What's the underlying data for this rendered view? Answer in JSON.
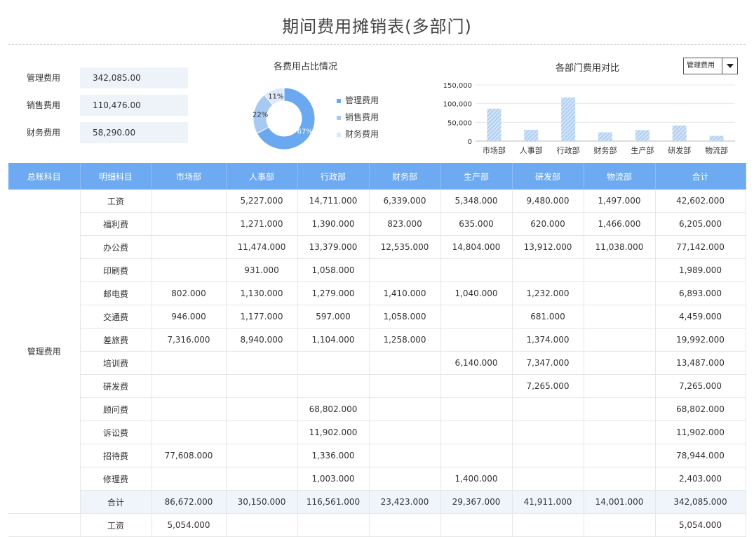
{
  "title": "期间费用摊销表(多部门)",
  "summary": [
    {
      "label": "管理费用",
      "value": "342,085.00"
    },
    {
      "label": "销售费用",
      "value": "110,476.00"
    },
    {
      "label": "财务费用",
      "value": "58,290.00"
    }
  ],
  "dropdown": {
    "selected": "管理费用"
  },
  "colors": {
    "header": "#6daaf1",
    "bar": "#a9cbee",
    "pie1": "#6aa8f0",
    "pie2": "#a7c9f2",
    "pie3": "#dde9f8"
  },
  "chart_data": [
    {
      "type": "pie",
      "title": "各费用占比情况",
      "categories": [
        "管理费用",
        "销售费用",
        "财务费用"
      ],
      "values": [
        67,
        22,
        11
      ],
      "labels": [
        "67%",
        "22%",
        "11%"
      ],
      "legend": "right"
    },
    {
      "type": "bar",
      "title": "各部门费用对比",
      "categories": [
        "市场部",
        "人事部",
        "行政部",
        "财务部",
        "生产部",
        "研发部",
        "物流部"
      ],
      "values": [
        86672,
        30150,
        116561,
        23423,
        29367,
        41911,
        14001
      ],
      "ylim": [
        0,
        150000
      ],
      "yticks": [
        0,
        50000,
        100000,
        150000
      ],
      "ytick_labels": [
        "0",
        "50,000",
        "100,000",
        "150,000"
      ],
      "grid": true
    }
  ],
  "table": {
    "headers": [
      "总账科目",
      "明细科目",
      "市场部",
      "人事部",
      "行政部",
      "财务部",
      "生产部",
      "研发部",
      "物流部",
      "合计"
    ],
    "group1": "管理费用",
    "rows": [
      [
        "工资",
        "",
        "5,227.000",
        "14,711.000",
        "6,339.000",
        "5,348.000",
        "9,480.000",
        "1,497.000",
        "42,602.000"
      ],
      [
        "福利费",
        "",
        "1,271.000",
        "1,390.000",
        "823.000",
        "635.000",
        "620.000",
        "1,466.000",
        "6,205.000"
      ],
      [
        "办公费",
        "",
        "11,474.000",
        "13,379.000",
        "12,535.000",
        "14,804.000",
        "13,912.000",
        "11,038.000",
        "77,142.000"
      ],
      [
        "印刷费",
        "",
        "931.000",
        "1,058.000",
        "",
        "",
        "",
        "",
        "1,989.000"
      ],
      [
        "邮电费",
        "802.000",
        "1,130.000",
        "1,279.000",
        "1,410.000",
        "1,040.000",
        "1,232.000",
        "",
        "6,893.000"
      ],
      [
        "交通费",
        "946.000",
        "1,177.000",
        "597.000",
        "1,058.000",
        "",
        "681.000",
        "",
        "4,459.000"
      ],
      [
        "差旅费",
        "7,316.000",
        "8,940.000",
        "1,104.000",
        "1,258.000",
        "",
        "1,374.000",
        "",
        "19,992.000"
      ],
      [
        "培训费",
        "",
        "",
        "",
        "",
        "6,140.000",
        "7,347.000",
        "",
        "13,487.000"
      ],
      [
        "研发费",
        "",
        "",
        "",
        "",
        "",
        "7,265.000",
        "",
        "7,265.000"
      ],
      [
        "顾问费",
        "",
        "",
        "68,802.000",
        "",
        "",
        "",
        "",
        "68,802.000"
      ],
      [
        "诉讼费",
        "",
        "",
        "11,902.000",
        "",
        "",
        "",
        "",
        "11,902.000"
      ],
      [
        "招待费",
        "77,608.000",
        "",
        "1,336.000",
        "",
        "",
        "",
        "",
        "78,944.000"
      ],
      [
        "修理费",
        "",
        "",
        "1,003.000",
        "",
        "1,400.000",
        "",
        "",
        "2,403.000"
      ]
    ],
    "total": [
      "合计",
      "86,672.000",
      "30,150.000",
      "116,561.000",
      "23,423.000",
      "29,367.000",
      "41,911.000",
      "14,001.000",
      "342,085.000"
    ],
    "group2_rows": [
      [
        "工资",
        "5,054.000",
        "",
        "",
        "",
        "",
        "",
        "",
        "5,054.000"
      ]
    ]
  }
}
